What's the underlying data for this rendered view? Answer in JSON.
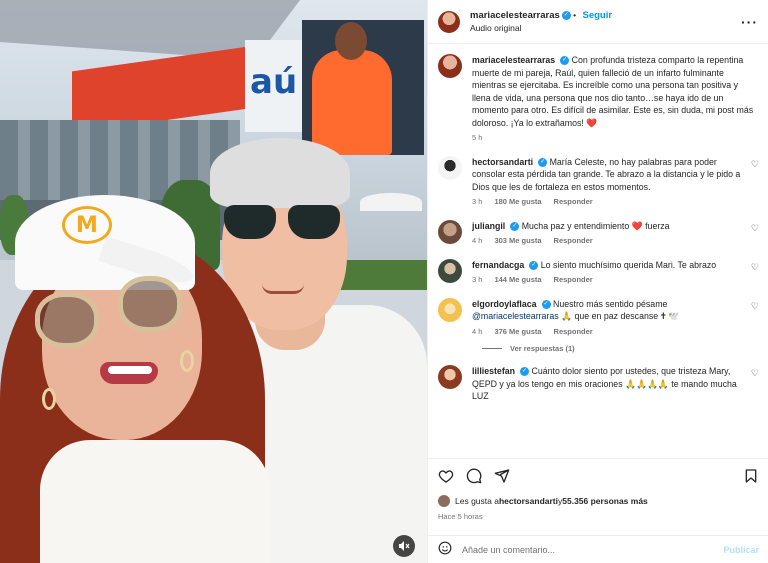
{
  "header": {
    "username": "mariacelestearraras",
    "follow_label": "Seguir",
    "audio_label": "Audio original",
    "more_icon": "more-horizontal-icon"
  },
  "caption": {
    "username": "mariacelestearraras",
    "text": "Con profunda tristeza comparto la repentina muerte de mi pareja, Raúl, quien falleció de un infarto fulminante mientras se ejercitaba. Es increíble como una persona tan positiva y llena de vida, una persona que nos dio tanto…se haya ido de un momento para otro. Es difícil de asimilar. Este es, sin duda, mi post más doloroso. ¡Ya lo extrañamos!",
    "emoji": "❤️",
    "time": "5 h"
  },
  "comments": [
    {
      "user": "hectorsandarti",
      "verified": true,
      "text": "María Celeste, no hay palabras para poder consolar esta pérdida tan grande. Te abrazo a la distancia y le pido a Dios que les de fortaleza en estos momentos.",
      "time": "3 h",
      "likes": "180 Me gusta",
      "reply": "Responder",
      "avatar_color": "#f4f4f4"
    },
    {
      "user": "juliangil",
      "verified": true,
      "text": "Mucha paz y entendimiento ❤️ fuerza",
      "time": "4 h",
      "likes": "303 Me gusta",
      "reply": "Responder",
      "avatar_color": "#c4a08a"
    },
    {
      "user": "fernandacga",
      "verified": true,
      "text": "Lo siento muchísimo querida Mari. Te abrazo",
      "time": "3 h",
      "likes": "144 Me gusta",
      "reply": "Responder",
      "avatar_color": "#6b7d6a"
    },
    {
      "user": "elgordoylaflaca",
      "verified": true,
      "text": "Nuestro más sentido pésame",
      "mention": "@mariacelestearraras",
      "text2": "🙏 que en paz descanse 🕇 🕊️",
      "time": "4 h",
      "likes": "376 Me gusta",
      "reply": "Responder",
      "avatar_color": "#f2c14e"
    },
    {
      "user": "lilliestefan",
      "verified": true,
      "text": "Cuánto dolor siento por ustedes, que tristeza Mary, QEPD y ya los tengo en mis oraciones 🙏🙏🙏🙏 te mando mucha LUZ",
      "time": "",
      "likes": "",
      "reply": "",
      "avatar_color": "#c9a46b"
    }
  ],
  "view_replies": "Ver respuestas (1)",
  "actions": {
    "like_icon": "heart-icon",
    "comment_icon": "comment-icon",
    "share_icon": "share-icon",
    "save_icon": "bookmark-icon"
  },
  "likes_line": {
    "prefix": "Les gusta a ",
    "user": "hectorsandarti",
    "middle": " y ",
    "count": "55.356 personas más"
  },
  "posted_ago": "Hace 5 horas",
  "add_comment": {
    "placeholder": "Añade un comentario...",
    "publish_label": "Publicar"
  },
  "photo": {
    "banner_text": "aú",
    "cap_logo": "M",
    "mute_icon": "speaker-muted-icon"
  }
}
